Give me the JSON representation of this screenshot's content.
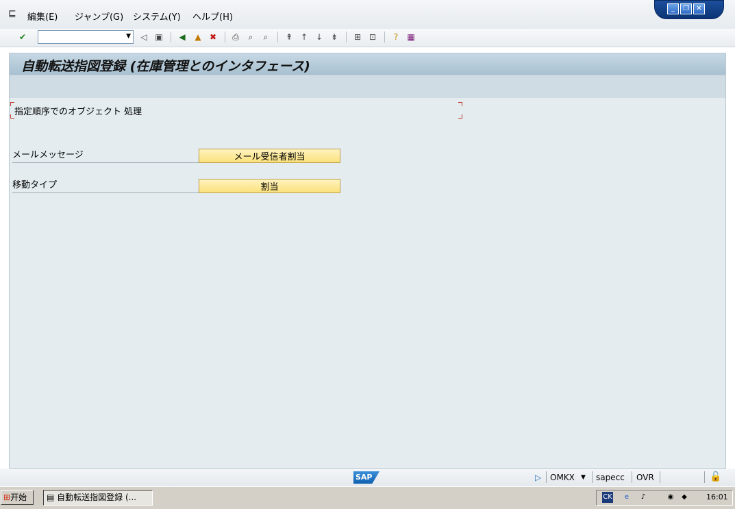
{
  "menu": {
    "items": [
      "編集(E)",
      "ジャンプ(G)",
      "システム(Y)",
      "ヘルプ(H)"
    ]
  },
  "toolbar": {
    "command_value": ""
  },
  "screen": {
    "title": "自動転送指図登録 (在庫管理とのインタフェース)",
    "group_label": "指定順序でのオブジェクト 処理",
    "rows": [
      {
        "label": "メールメッセージ",
        "button": "メール受信者割当"
      },
      {
        "label": "移動タイプ",
        "button": "割当"
      }
    ]
  },
  "statusbar": {
    "logo": "SAP",
    "transaction": "OMKX",
    "server": "sapecc",
    "mode": "OVR"
  },
  "taskbar": {
    "start_label": "开始",
    "task_label": "自動転送指図登録 (...",
    "tray_clock": "16:01"
  },
  "colors": {
    "content_bg": "#e4ecf0",
    "title_bar": "#a8c0d0",
    "button_yellow": "#fbe17c",
    "group_bracket": "#c0392b"
  }
}
